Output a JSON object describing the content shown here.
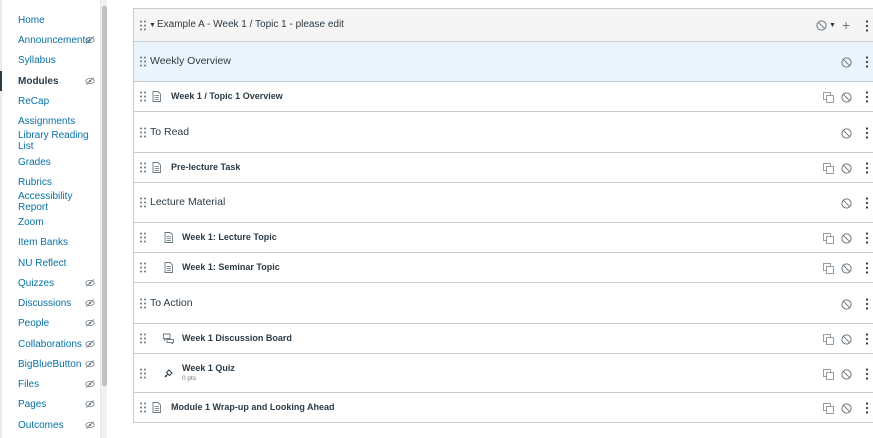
{
  "course_nav": {
    "items": [
      {
        "label": "Home",
        "hidden": false,
        "active": false
      },
      {
        "label": "Announcements",
        "hidden": true,
        "active": false
      },
      {
        "label": "Syllabus",
        "hidden": false,
        "active": false
      },
      {
        "label": "Modules",
        "hidden": true,
        "active": true
      },
      {
        "label": "ReCap",
        "hidden": false,
        "active": false
      },
      {
        "label": "Assignments",
        "hidden": false,
        "active": false
      },
      {
        "label": "Library Reading List",
        "hidden": false,
        "active": false
      },
      {
        "label": "Grades",
        "hidden": false,
        "active": false
      },
      {
        "label": "Rubrics",
        "hidden": false,
        "active": false
      },
      {
        "label": "Accessibility Report",
        "hidden": false,
        "active": false
      },
      {
        "label": "Zoom",
        "hidden": false,
        "active": false
      },
      {
        "label": "Item Banks",
        "hidden": false,
        "active": false
      },
      {
        "label": "NU Reflect",
        "hidden": false,
        "active": false
      },
      {
        "label": "Quizzes",
        "hidden": true,
        "active": false
      },
      {
        "label": "Discussions",
        "hidden": true,
        "active": false
      },
      {
        "label": "People",
        "hidden": true,
        "active": false
      },
      {
        "label": "Collaborations",
        "hidden": true,
        "active": false
      },
      {
        "label": "BigBlueButton",
        "hidden": true,
        "active": false
      },
      {
        "label": "Files",
        "hidden": true,
        "active": false
      },
      {
        "label": "Pages",
        "hidden": true,
        "active": false
      },
      {
        "label": "Outcomes",
        "hidden": true,
        "active": false
      }
    ]
  },
  "module": {
    "title": "Example A - Week 1 / Topic 1 - please edit",
    "items": [
      {
        "kind": "subheader",
        "title": "Weekly Overview"
      },
      {
        "kind": "page",
        "title": "Week 1 / Topic 1 Overview",
        "indent": 0
      },
      {
        "kind": "subheader",
        "title": "To Read"
      },
      {
        "kind": "page",
        "title": "Pre-lecture Task",
        "indent": 0
      },
      {
        "kind": "subheader",
        "title": "Lecture Material"
      },
      {
        "kind": "page",
        "title": "Week 1: Lecture Topic",
        "indent": 1
      },
      {
        "kind": "page",
        "title": "Week 1: Seminar Topic",
        "indent": 1
      },
      {
        "kind": "subheader",
        "title": "To Action"
      },
      {
        "kind": "discussion",
        "title": "Week 1 Discussion Board",
        "indent": 1
      },
      {
        "kind": "quiz",
        "title": "Week 1 Quiz",
        "indent": 1,
        "subtitle": "0 pts"
      },
      {
        "kind": "page",
        "title": "Module 1 Wrap-up and Looking Ahead",
        "indent": 0
      }
    ]
  },
  "colors": {
    "link": "#0770a3",
    "text": "#2d3b45",
    "icon": "#6b7780",
    "border": "#c7cdd1",
    "header_bg": "#f5f5f5",
    "highlight_bg": "#eaf4fb"
  }
}
